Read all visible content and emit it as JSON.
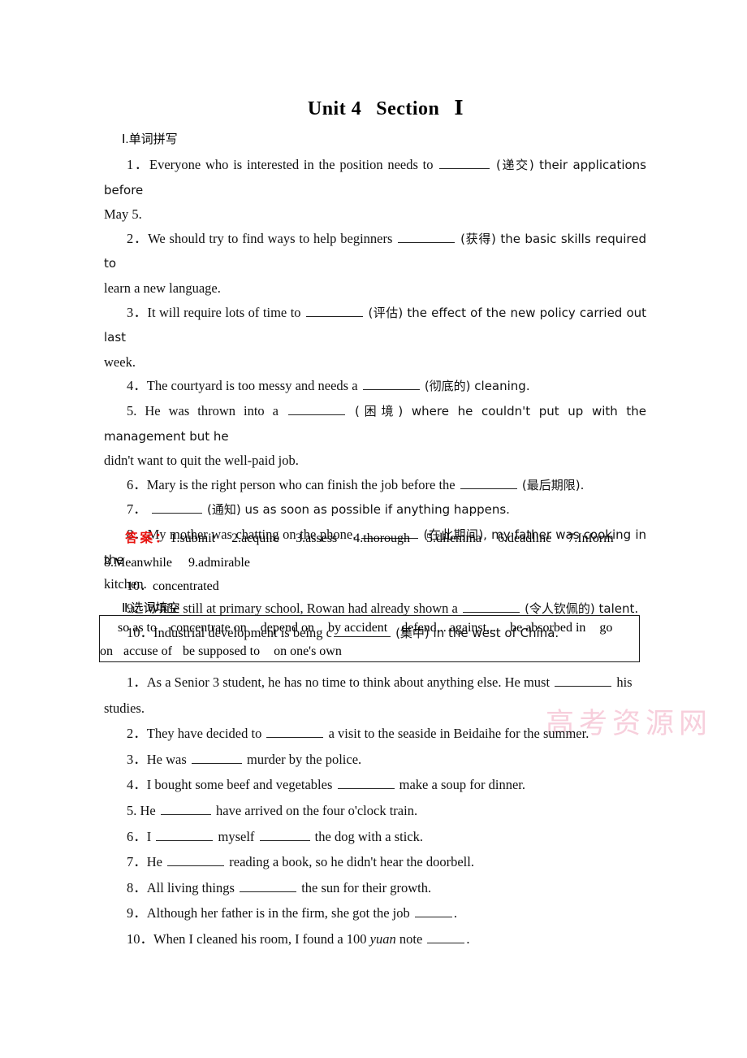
{
  "title": {
    "unit": "Unit 4",
    "section": "Section",
    "numeral": "Ⅰ"
  },
  "sections": [
    {
      "id": "spelling",
      "label": "Ⅰ.单词拼写"
    },
    {
      "id": "cloze",
      "label": "Ⅱ.选词填空"
    }
  ],
  "spelling": {
    "q1a": "1．Everyone who is interested in the position needs to",
    "q1b": "(递交) their applications before",
    "q1c": "May 5.",
    "q2a": "2．We should try to find ways to help beginners",
    "q2b": "(获得) the basic skills required to",
    "q2c": "learn a new language.",
    "q3a": "3．It will require lots of time to",
    "q3b": "(评估) the effect of the new policy carried out last",
    "q3c": "week.",
    "q4a": "4．The courtyard is too messy and needs a",
    "q4b": "(彻底的) cleaning.",
    "q5a": "5. He was thrown into a",
    "q5b": "(困境) where he couldn't put up with the management but he",
    "q5c": "didn't want to quit the well-paid job.",
    "q6a": "6．Mary is the right person who can finish the job before the",
    "q6b": "(最后期限).",
    "q7a": "7．",
    "q7b": "(通知) us as soon as possible if anything happens.",
    "q8a": "8．My mother was chatting on the phone.",
    "q8b": "(在此期间), my father was cooking in the",
    "q8c": "kitchen.",
    "q9a": "9．While still at primary school, Rowan had already shown a",
    "q9b": "(令人钦佩的) talent.",
    "q10a": "10．Industrial development is being c",
    "q10b": "(集中) in the west of China."
  },
  "answers": {
    "label": "答案：",
    "items": [
      "1.submit",
      "2.acquire",
      "3.assess",
      "4.thorough",
      "5.dilemma",
      "6.deadline",
      "7.Inform",
      "8.Meanwhile",
      "9.admirable"
    ],
    "last": "10．concentrated"
  },
  "word_bank": {
    "line1": [
      "so as to",
      "concentrate on",
      "depend on",
      "by accident",
      "defend... against...",
      "be absorbed in",
      "go"
    ],
    "line2": [
      "on",
      "accuse of",
      "be supposed to",
      "on one's own"
    ]
  },
  "cloze": {
    "q1a": "1．As a Senior 3 student, he has no time to think about anything else. He must",
    "q1b": "his",
    "q1c": "studies.",
    "q2a": "2．They have decided to",
    "q2b": "a visit to the seaside in Beidaihe for the summer.",
    "q3a": "3．He was",
    "q3b": "murder by the police.",
    "q4a": "4．I bought some beef and vegetables",
    "q4b": "make a soup for dinner.",
    "q5a": "5. He",
    "q5b": "have arrived on the four o'clock train.",
    "q6a": "6．I",
    "q6b": "myself",
    "q6c": "the dog with a stick.",
    "q7a": "7．He",
    "q7b": "reading a book, so he didn't hear the doorbell.",
    "q8a": "8．All living things",
    "q8b": "the sun for their growth.",
    "q9a": "9．Although her father is in the firm, she got the job",
    "q9b": ".",
    "q10a": "10．When I cleaned his room, I found a 100",
    "q10b": "yuan",
    "q10c": "note",
    "q10d": "."
  },
  "watermark": {
    "text": "高考资源网",
    "color": "#f2a9c0"
  }
}
